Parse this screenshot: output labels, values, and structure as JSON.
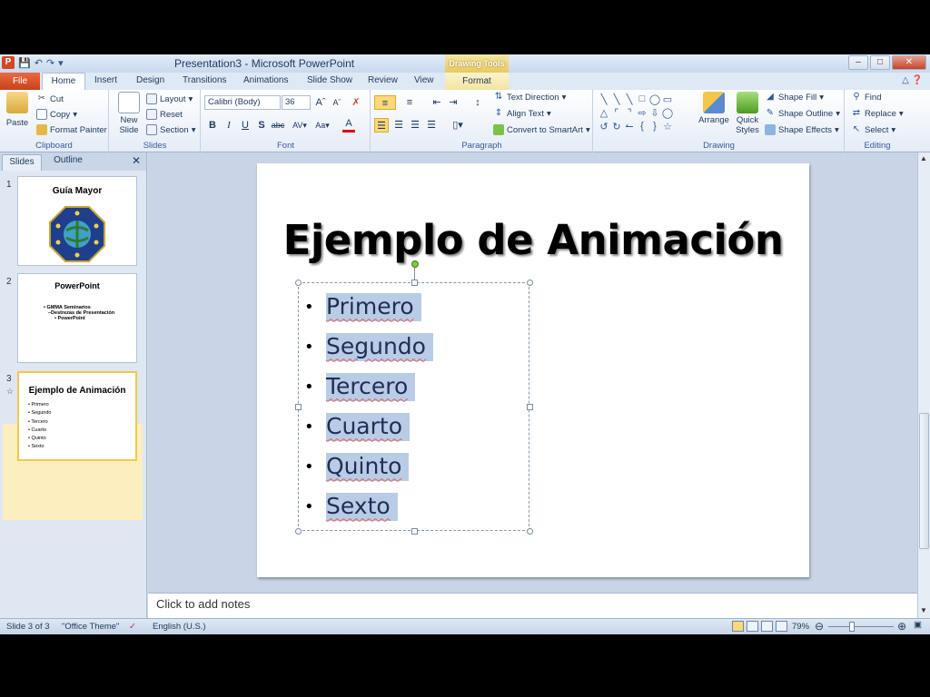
{
  "window": {
    "title": "Presentation3 - Microsoft PowerPoint",
    "context_tab_group": "Drawing Tools"
  },
  "tabs": [
    "File",
    "Home",
    "Insert",
    "Design",
    "Transitions",
    "Animations",
    "Slide Show",
    "Review",
    "View",
    "Format"
  ],
  "ribbon": {
    "clipboard": {
      "label": "Clipboard",
      "paste": "Paste",
      "cut": "Cut",
      "copy": "Copy",
      "format_painter": "Format Painter"
    },
    "slides": {
      "label": "Slides",
      "new_slide_1": "New",
      "new_slide_2": "Slide",
      "layout": "Layout",
      "reset": "Reset",
      "section": "Section"
    },
    "font": {
      "label": "Font",
      "font_name": "Calibri (Body)",
      "font_size": "36"
    },
    "paragraph": {
      "label": "Paragraph",
      "text_direction": "Text Direction",
      "align_text": "Align Text",
      "convert_smartart": "Convert to SmartArt"
    },
    "drawing": {
      "label": "Drawing",
      "arrange": "Arrange",
      "quick_styles_1": "Quick",
      "quick_styles_2": "Styles",
      "shape_fill": "Shape Fill",
      "shape_outline": "Shape Outline",
      "shape_effects": "Shape Effects"
    },
    "editing": {
      "label": "Editing",
      "find": "Find",
      "replace": "Replace",
      "select": "Select"
    }
  },
  "pane": {
    "tab_slides": "Slides",
    "tab_outline": "Outline",
    "thumbnails": [
      {
        "num": "1",
        "title": "Guía Mayor"
      },
      {
        "num": "2",
        "title": "PowerPoint",
        "lines": [
          "• GMMA Seminarios",
          "–Destrezas de Presentación",
          "• PowerPoint"
        ]
      },
      {
        "num": "3",
        "title": "Ejemplo de Animación",
        "lines": [
          "• Primero",
          "• Segundo",
          "• Tercero",
          "• Cuarto",
          "• Quinto",
          "• Sexto"
        ]
      }
    ]
  },
  "slide": {
    "title": "Ejemplo de Animación",
    "bullets": [
      "Primero",
      "Segundo",
      "Tercero",
      "Cuarto",
      "Quinto",
      "Sexto"
    ]
  },
  "notes_placeholder": "Click to add notes",
  "status": {
    "slide_info": "Slide 3 of 3",
    "theme": "\"Office Theme\"",
    "language": "English (U.S.)",
    "zoom": "79%"
  },
  "colors": {
    "file_tab": "#c6431c",
    "selection": "#b9cce6",
    "ribbon_bg": "#e4ecf7"
  }
}
